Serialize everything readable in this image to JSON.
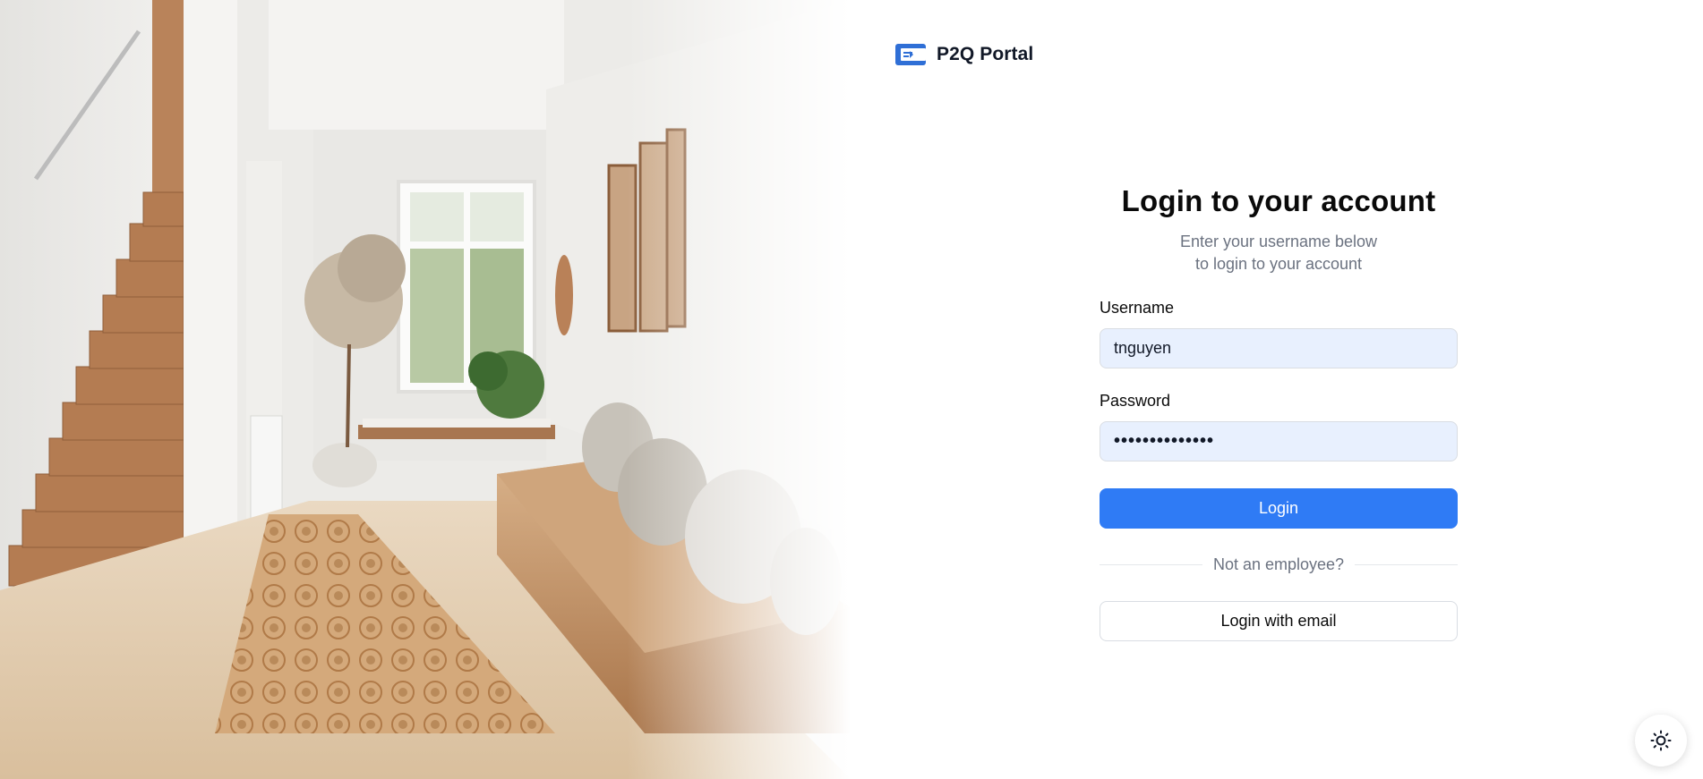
{
  "brand": {
    "name": "P2Q Portal",
    "logo_icon": "portal-logo-icon",
    "accent": "#2f6fd6"
  },
  "login": {
    "title": "Login to your account",
    "subtitle_line1": "Enter your username below",
    "subtitle_line2": "to login to your account",
    "username_label": "Username",
    "username_value": "tnguyen",
    "password_label": "Password",
    "password_value": "••••••••••••••",
    "submit_label": "Login",
    "divider_text": "Not an employee?",
    "email_login_label": "Login with email"
  },
  "theme_toggle": {
    "icon": "sun-icon"
  },
  "hero": {
    "icon": "hallway-illustration"
  },
  "colors": {
    "primary": "#2f7bf5",
    "input_bg": "#e8f0fe",
    "muted_text": "#6b7280"
  }
}
